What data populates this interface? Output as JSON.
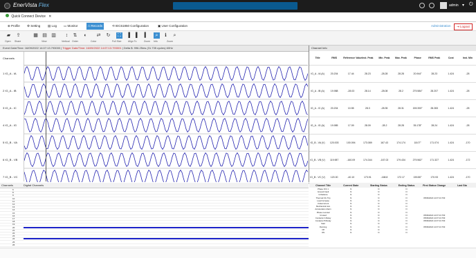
{
  "app": {
    "brand": "EnerVista",
    "brand_suffix": "Flex",
    "user": "admin"
  },
  "tabs": [
    {
      "label": "Quick Connect Device"
    }
  ],
  "menu": [
    {
      "label": "Profile"
    },
    {
      "label": "Setting"
    },
    {
      "label": "Log"
    },
    {
      "label": "Monitor"
    },
    {
      "label": "Records",
      "active": true
    },
    {
      "label": "IEC61850 Configuration"
    },
    {
      "label": "User Configuration"
    }
  ],
  "menu_right": {
    "admin": "Administration",
    "logout": "Logout"
  },
  "toolbar_labels": [
    "Open",
    "Share",
    "View",
    "Vertical",
    "Order",
    "Color",
    "Full Size",
    "Align To",
    "Zoom",
    "Info",
    "Zoom"
  ],
  "infobar": {
    "prefix": "Event Date/Time: 16/09/2022 14:07:13.793000 |",
    "trigger": "Trigger Date/Time: 16/09/2022 14:07:13.793001",
    "suffix": "| Delta $: 996.25ms (31.735 cycles) 60Hz"
  },
  "channel_info_title": "Channel Info",
  "channels_header": "Channels",
  "channels": [
    {
      "num": "1",
      "label": "IG_A - IA"
    },
    {
      "num": "2",
      "label": "IG_A - IB"
    },
    {
      "num": "3",
      "label": "IG_A - IC"
    },
    {
      "num": "4",
      "label": "IG_A - IG"
    },
    {
      "num": "5",
      "label": "IG_B - VA"
    },
    {
      "num": "6",
      "label": "IG_B - VB"
    },
    {
      "num": "7",
      "label": "IG_B - VC"
    }
  ],
  "info_table": {
    "headers": [
      "Title",
      "RMS",
      "Reference Value",
      "Inst. Peak",
      "Min. Peak",
      "Max. Peak",
      "Phase",
      "RMS Peak",
      "Cost",
      "Inst. Min"
    ],
    "rows": [
      [
        "IG_A - IA (A)",
        "20.204",
        "17.44",
        "28.23",
        "-28.28",
        "28.28",
        "20.944°",
        "28.23",
        "1.424",
        "-28"
      ],
      [
        "IG_A - IB (A)",
        "19.988",
        "-28.03",
        "28.14",
        "-28.08",
        "28.2",
        "279.584°",
        "28.207",
        "1.424",
        "-28"
      ],
      [
        "IG_A - IC (A)",
        "20.204",
        "10.55",
        "28.3",
        "-28.35",
        "28.31",
        "159.393°",
        "28.283",
        "1.424",
        "-28"
      ],
      [
        "IG_A - IG (A)",
        "19.985",
        "17.09",
        "28.09",
        "-28.2",
        "28.28",
        "35.178°",
        "28.24",
        "1.424",
        "-28"
      ],
      [
        "IG_B - VA (V)",
        "120.003",
        "100.094",
        "173.089",
        "167.43",
        "174.174",
        "18.07°",
        "171.074",
        "1.424",
        "-170"
      ],
      [
        "IG_B - VB (V)",
        "119.987",
        "-160.09",
        "174.344",
        "-167.02",
        "179.434",
        "279.562°",
        "171.327",
        "1.424",
        "-172"
      ],
      [
        "IG_B - VC (V)",
        "120.00",
        "-40.10",
        "173.91",
        "-168.8",
        "172.17",
        "159.80°",
        "170.93",
        "1.424",
        "-170"
      ]
    ]
  },
  "digital": {
    "header_channels": "Channels",
    "header_digital": "Digital Channels",
    "rows": [
      {
        "num": "6",
        "on": false
      },
      {
        "num": "8",
        "on": false
      },
      {
        "num": "9",
        "on": false
      },
      {
        "num": "10",
        "on": false
      },
      {
        "num": "11",
        "on": false
      },
      {
        "num": "12",
        "on": false
      },
      {
        "num": "13",
        "on": false
      },
      {
        "num": "14",
        "on": false
      },
      {
        "num": "15",
        "on": false
      },
      {
        "num": "16",
        "on": false
      },
      {
        "num": "17",
        "on": false
      },
      {
        "num": "18",
        "on": false
      },
      {
        "num": "19",
        "on": false
      },
      {
        "num": "20",
        "on": true
      },
      {
        "num": "21",
        "on": false
      },
      {
        "num": "22",
        "on": false
      },
      {
        "num": "23",
        "on": false
      },
      {
        "num": "24",
        "on": true
      },
      {
        "num": "25",
        "on": false
      },
      {
        "num": "26",
        "on": false
      }
    ]
  },
  "digital_table": {
    "headers": [
      "Channel Title",
      "Current State",
      "Starting Status",
      "Ending Status",
      "First Status Change",
      "Last Sta"
    ],
    "rows": [
      [
        "Phase IOC 1",
        "N",
        "N",
        "N",
        ""
      ],
      [
        "Ground Fault",
        "N",
        "N",
        "N",
        ""
      ],
      [
        "Unbalance",
        "N",
        "N",
        "N",
        ""
      ],
      [
        "Thermal O/L Trip",
        "N",
        "N",
        "N",
        "05/09/2022 14:07:13.793"
      ],
      [
        "Load Increase",
        "N",
        "N",
        "N",
        ""
      ],
      [
        "Undercurrent",
        "N",
        "N",
        "N",
        ""
      ],
      [
        "Mechanical Jam",
        "N",
        "N",
        "N",
        ""
      ],
      [
        "Acceleration Alarm",
        "N",
        "N",
        "N",
        ""
      ],
      [
        "Phase reversal",
        "N",
        "N",
        "N",
        ""
      ],
      [
        "Unused",
        "N",
        "N",
        "N",
        "05/09/2022 14:07:13.793"
      ],
      [
        "Contactor A Relay",
        "N",
        "N",
        "N",
        "05/09/2022 14:07:13.793"
      ],
      [
        "Contactor B Relay",
        "N",
        "N",
        "N",
        "05/09/2022 14:07:13.793"
      ],
      [
        "Start",
        "N",
        "N",
        "N",
        ""
      ],
      [
        "Running",
        "N",
        "N",
        "N",
        "05/09/2022 14:07:13.793"
      ],
      [
        "Off",
        "N",
        "N",
        "N",
        ""
      ],
      [
        "ON",
        "N",
        "N",
        "N",
        ""
      ]
    ]
  },
  "colors": {
    "accent": "#3c8fd1",
    "wave": "#2424b0",
    "digital_on": "#1a20c8",
    "title_bg": "#1c1c1c"
  }
}
